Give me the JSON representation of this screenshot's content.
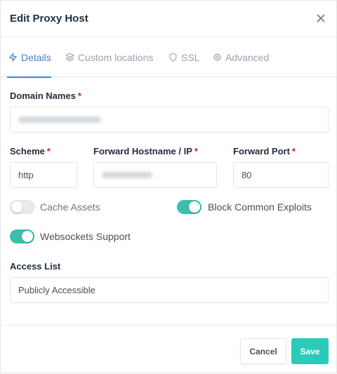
{
  "dialog": {
    "title": "Edit Proxy Host"
  },
  "tabs": [
    {
      "label": "Details",
      "icon": "bolt-icon",
      "active": true
    },
    {
      "label": "Custom locations",
      "icon": "layers-icon",
      "active": false
    },
    {
      "label": "SSL",
      "icon": "shield-icon",
      "active": false
    },
    {
      "label": "Advanced",
      "icon": "gear-icon",
      "active": false
    }
  ],
  "form": {
    "domain_names": {
      "label": "Domain Names",
      "required_mark": "*"
    },
    "scheme": {
      "label": "Scheme",
      "required_mark": "*",
      "value": "http"
    },
    "forward_hostname": {
      "label": "Forward Hostname / IP",
      "required_mark": "*"
    },
    "forward_port": {
      "label": "Forward Port",
      "required_mark": "*",
      "value": "80"
    },
    "cache_assets": {
      "label": "Cache Assets",
      "enabled": false
    },
    "block_exploits": {
      "label": "Block Common Exploits",
      "enabled": true
    },
    "websockets": {
      "label": "Websockets Support",
      "enabled": true
    },
    "access_list": {
      "label": "Access List",
      "value": "Publicly Accessible"
    }
  },
  "footer": {
    "cancel_label": "Cancel",
    "save_label": "Save"
  },
  "colors": {
    "accent": "#467fcf",
    "toggle_on": "#3bbfad",
    "save": "#2bcbba",
    "required": "#cd201f"
  }
}
